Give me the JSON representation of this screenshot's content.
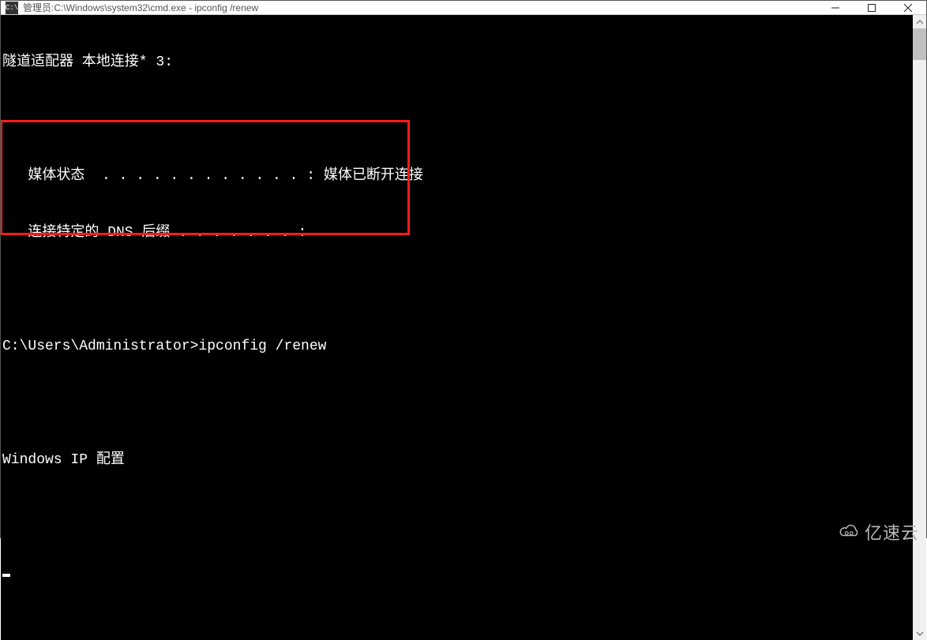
{
  "titlebar": {
    "prefix": "管理员: ",
    "path": "C:\\Windows\\system32\\cmd.exe - ipconfig  /renew"
  },
  "terminal": {
    "lines": [
      "隧道适配器 本地连接* 3:",
      "",
      "   媒体状态  . . . . . . . . . . . . : 媒体已断开连接",
      "   连接特定的 DNS 后缀 . . . . . . . :",
      "",
      "C:\\Users\\Administrator>ipconfig /renew",
      "",
      "Windows IP 配置",
      "",
      ""
    ]
  },
  "watermark": {
    "text": "亿速云"
  }
}
